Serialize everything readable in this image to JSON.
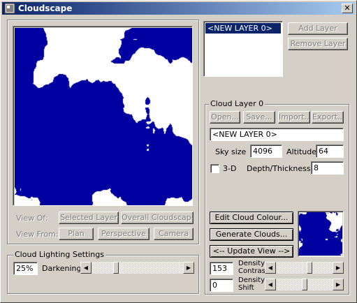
{
  "window": {
    "title": "Cloudscape",
    "close": "✕"
  },
  "preview": {
    "view_of_label": "View Of:",
    "view_from_label": "View From:",
    "selected_layer": "Selected Layer",
    "overall": "Overall Cloudscape",
    "plan": "Plan",
    "perspective": "Perspective",
    "camera": "Camera"
  },
  "layers": {
    "items": [
      "<NEW LAYER 0>"
    ],
    "add": "Add Layer",
    "remove": "Remove Layer"
  },
  "cloud_layer": {
    "title": "Cloud Layer 0",
    "open": "Open...",
    "save": "Save...",
    "import": "Import...",
    "export": "Export...",
    "name": "<NEW LAYER 0>",
    "sky_size_label": "Sky size",
    "sky_size": "4096",
    "altitude_label": "Altitude",
    "altitude": "64",
    "three_d_label": "3-D",
    "three_d_checked": false,
    "depth_label": "Depth/Thickness",
    "depth": "8",
    "edit_colour": "Edit Cloud Colour...",
    "generate": "Generate Clouds...",
    "update_view": "<-- Update View -->",
    "density_contrast_label_1": "Density",
    "density_contrast_label_2": "Contrast",
    "density_contrast": "153",
    "density_contrast_fraction": 0.6,
    "density_shift_label_1": "Density",
    "density_shift_label_2": "Shift",
    "density_shift": "0",
    "density_shift_fraction": 0.5
  },
  "lighting": {
    "title": "Cloud Lighting Settings",
    "percent": "25%",
    "darkening_label": "Darkening",
    "darkening_fraction": 0.25
  },
  "colors": {
    "cloud_blue": "#0000a0",
    "title_start": "#0a246a",
    "title_end": "#a6caf0"
  }
}
